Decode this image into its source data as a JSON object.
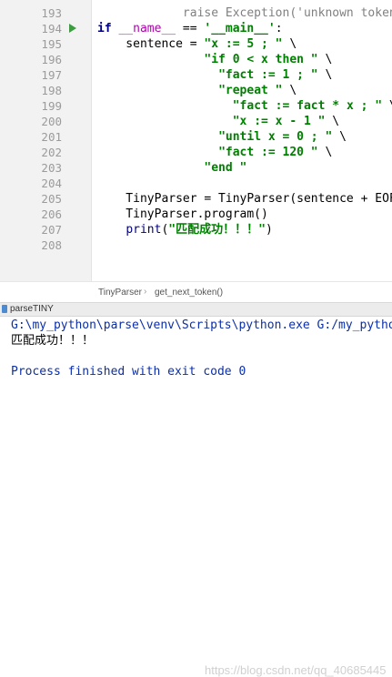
{
  "editor": {
    "lines": [
      {
        "num": "193",
        "segs": [
          {
            "t": "            raise Exception('unknown token: ' + s",
            "c": "cm"
          }
        ]
      },
      {
        "num": "194",
        "run": true,
        "segs": [
          {
            "t": "if ",
            "c": "kw"
          },
          {
            "t": "__name__",
            "c": "dunder"
          },
          {
            "t": " == ",
            "c": ""
          },
          {
            "t": "'__main__'",
            "c": "str"
          },
          {
            "t": ":",
            "c": ""
          }
        ]
      },
      {
        "num": "195",
        "segs": [
          {
            "t": "    sentence = ",
            "c": ""
          },
          {
            "t": "\"x := 5 ; \"",
            "c": "str"
          },
          {
            "t": " \\",
            "c": ""
          }
        ]
      },
      {
        "num": "196",
        "segs": [
          {
            "t": "               ",
            "c": ""
          },
          {
            "t": "\"if 0 < x then \"",
            "c": "str"
          },
          {
            "t": " \\",
            "c": ""
          }
        ]
      },
      {
        "num": "197",
        "segs": [
          {
            "t": "                 ",
            "c": ""
          },
          {
            "t": "\"fact := 1 ; \"",
            "c": "str"
          },
          {
            "t": " \\",
            "c": ""
          }
        ]
      },
      {
        "num": "198",
        "segs": [
          {
            "t": "                 ",
            "c": ""
          },
          {
            "t": "\"repeat \"",
            "c": "str"
          },
          {
            "t": " \\",
            "c": ""
          }
        ]
      },
      {
        "num": "199",
        "segs": [
          {
            "t": "                   ",
            "c": ""
          },
          {
            "t": "\"fact := fact * x ; \"",
            "c": "str"
          },
          {
            "t": " \\",
            "c": ""
          }
        ]
      },
      {
        "num": "200",
        "segs": [
          {
            "t": "                   ",
            "c": ""
          },
          {
            "t": "\"x := x - 1 \"",
            "c": "str"
          },
          {
            "t": " \\",
            "c": ""
          }
        ]
      },
      {
        "num": "201",
        "segs": [
          {
            "t": "                 ",
            "c": ""
          },
          {
            "t": "\"until x = 0 ; \"",
            "c": "str"
          },
          {
            "t": " \\",
            "c": ""
          }
        ]
      },
      {
        "num": "202",
        "segs": [
          {
            "t": "                 ",
            "c": ""
          },
          {
            "t": "\"fact := 120 \"",
            "c": "str"
          },
          {
            "t": " \\",
            "c": ""
          }
        ]
      },
      {
        "num": "203",
        "segs": [
          {
            "t": "               ",
            "c": ""
          },
          {
            "t": "\"end \"",
            "c": "str"
          }
        ]
      },
      {
        "num": "204",
        "segs": []
      },
      {
        "num": "205",
        "segs": [
          {
            "t": "    TinyParser = TinyParser(sentence + EOF)",
            "c": ""
          }
        ]
      },
      {
        "num": "206",
        "segs": [
          {
            "t": "    TinyParser.program()",
            "c": ""
          }
        ]
      },
      {
        "num": "207",
        "segs": [
          {
            "t": "    ",
            "c": ""
          },
          {
            "t": "print",
            "c": "builtin"
          },
          {
            "t": "(",
            "c": ""
          },
          {
            "t": "\"匹配成功！！！\"",
            "c": "str"
          },
          {
            "t": ")",
            "c": ""
          }
        ]
      },
      {
        "num": "208",
        "segs": []
      }
    ]
  },
  "breadcrumb": {
    "items": [
      "TinyParser",
      "get_next_token()"
    ],
    "separator": "›"
  },
  "run_window": {
    "tab_label": "parseTINY",
    "console": [
      {
        "text": "G:\\my_python\\parse\\venv\\Scripts\\python.exe G:/my_pytho",
        "kind": "console-cmd"
      },
      {
        "text": "匹配成功！！！",
        "kind": "console-out"
      },
      {
        "text": "",
        "kind": "console-out"
      },
      {
        "text": "Process finished with exit code 0",
        "kind": "console-exit"
      }
    ],
    "watermark": "https://blog.csdn.net/qq_40685445"
  },
  "colors": {
    "keyword": "#000080",
    "string": "#008000",
    "dunder": "#b200b2",
    "run_green": "#3d9b40"
  },
  "icons": {
    "run_gutter": "run-arrow-icon",
    "tool_window": "python-run-icon"
  }
}
